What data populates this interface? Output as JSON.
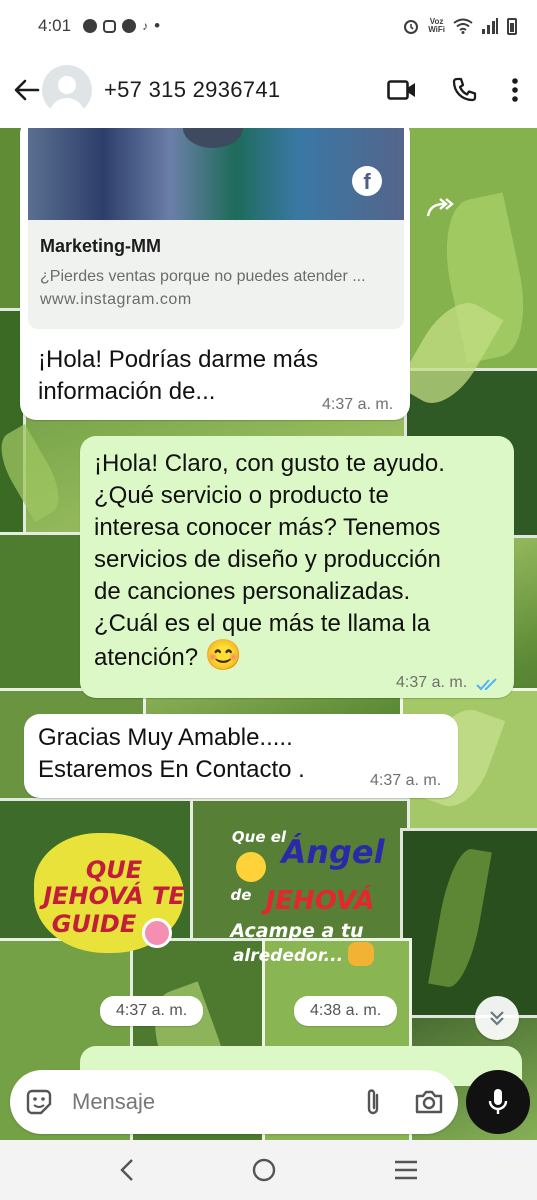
{
  "status_bar": {
    "time": "4:01",
    "notif_dot": "•",
    "volte_top": "Voz",
    "volte_bottom": "WiFi"
  },
  "header": {
    "contact_name": "+57 315 2936741",
    "icons": [
      "back-arrow-icon",
      "avatar",
      "video-call-icon",
      "phone-icon",
      "more-icon"
    ]
  },
  "messages": {
    "m1": {
      "link_title": "Marketing-MM",
      "link_description": "¿Pierdes ventas porque no puedes atender ...",
      "link_domain": "www.instagram.com",
      "link_source_icon": "f",
      "text_line1": "¡Hola! Podrías darme más",
      "text_line2": "información de...",
      "time": "4:37 a. m."
    },
    "m2": {
      "lines": [
        "¡Hola! Claro, con gusto te ayudo.",
        "¿Qué servicio o producto te",
        "interesa conocer más? Tenemos",
        "servicios de diseño y producción",
        "de canciones personalizadas.",
        "¿Cuál es el que más te llama la",
        "atención?"
      ],
      "emoji": "😊",
      "time": "4:37 a. m.",
      "status": "read"
    },
    "m3": {
      "line1": "Gracias Muy Amable.....",
      "line2": "Estaremos En Contacto .",
      "time": "4:37 a. m."
    },
    "sticker1": {
      "line1": "QUE",
      "line2": "JEHOVÁ TE",
      "line3": "GUIDE",
      "time": "4:37 a. m."
    },
    "sticker2": {
      "line1": "Que el",
      "line2": "Ángel",
      "line3": "de",
      "line4": "JEHOVÁ",
      "line5": "Acampe a tu",
      "line6": "alrededor...",
      "time": "4:38 a. m."
    }
  },
  "input": {
    "placeholder": "Mensaje"
  },
  "colors": {
    "incoming_bubble": "#ffffff",
    "outgoing_bubble": "#dcf8c6",
    "read_ticks": "#4fb3f6"
  }
}
